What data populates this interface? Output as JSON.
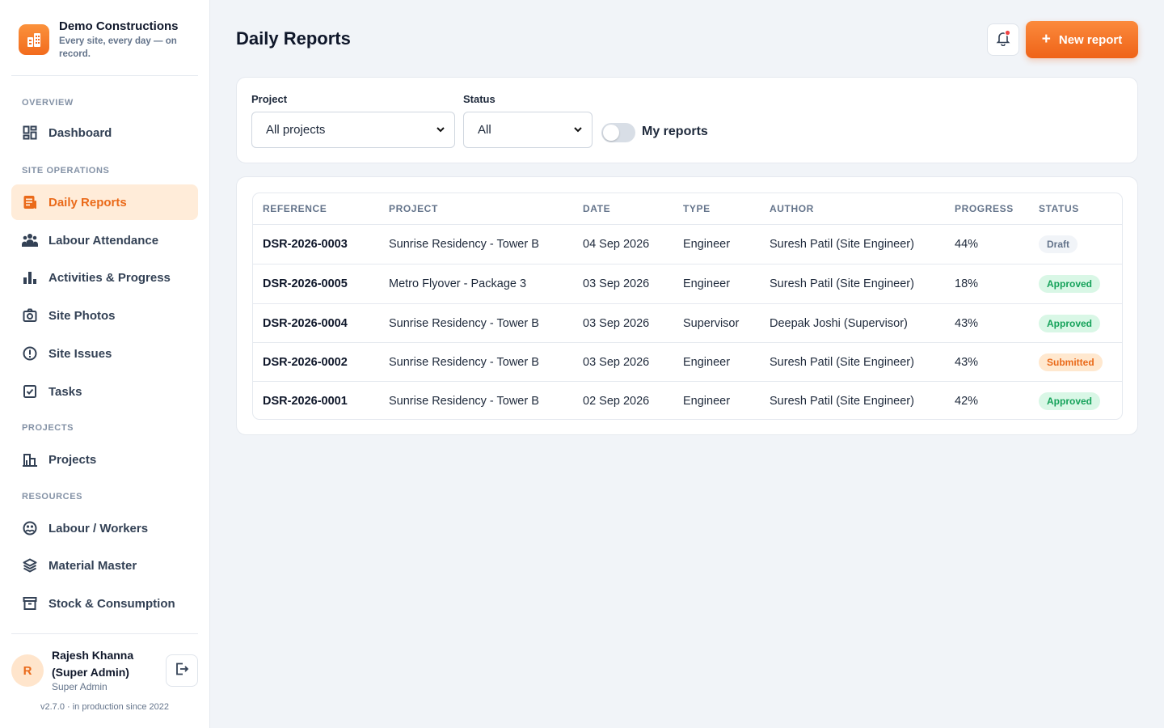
{
  "brand": {
    "name": "Demo Constructions",
    "tagline": "Every site, every day — on record."
  },
  "sidebar": {
    "sections": [
      {
        "label": "OVERVIEW",
        "items": [
          {
            "label": "Dashboard",
            "icon": "dashboard-icon"
          }
        ]
      },
      {
        "label": "SITE OPERATIONS",
        "items": [
          {
            "label": "Daily Reports",
            "icon": "report-icon",
            "active": true
          },
          {
            "label": "Labour Attendance",
            "icon": "people-icon"
          },
          {
            "label": "Activities & Progress",
            "icon": "bar-chart-icon"
          },
          {
            "label": "Site Photos",
            "icon": "camera-icon"
          },
          {
            "label": "Site Issues",
            "icon": "alert-circle-icon"
          },
          {
            "label": "Tasks",
            "icon": "checkbox-icon"
          }
        ]
      },
      {
        "label": "PROJECTS",
        "items": [
          {
            "label": "Projects",
            "icon": "building-icon"
          }
        ]
      },
      {
        "label": "RESOURCES",
        "items": [
          {
            "label": "Labour / Workers",
            "icon": "workers-icon"
          },
          {
            "label": "Material Master",
            "icon": "layers-icon"
          },
          {
            "label": "Stock & Consumption",
            "icon": "archive-icon"
          }
        ]
      }
    ]
  },
  "user": {
    "initial": "R",
    "name": "Rajesh Khanna (Super Admin)",
    "role": "Super Admin"
  },
  "version": "v2.7.0 · in production since 2022",
  "header": {
    "title": "Daily Reports",
    "new_label": "New report"
  },
  "filters": {
    "project_label": "Project",
    "project_value": "All projects",
    "status_label": "Status",
    "status_value": "All",
    "toggle_label": "My reports",
    "toggle_on": false
  },
  "table": {
    "columns": [
      "REFERENCE",
      "PROJECT",
      "DATE",
      "TYPE",
      "AUTHOR",
      "PROGRESS",
      "STATUS"
    ],
    "rows": [
      {
        "ref": "DSR-2026-0003",
        "project": "Sunrise Residency - Tower B",
        "date": "04 Sep 2026",
        "type": "Engineer",
        "author": "Suresh Patil (Site Engineer)",
        "progress": "44%",
        "status": "Draft"
      },
      {
        "ref": "DSR-2026-0005",
        "project": "Metro Flyover - Package 3",
        "date": "03 Sep 2026",
        "type": "Engineer",
        "author": "Suresh Patil (Site Engineer)",
        "progress": "18%",
        "status": "Approved"
      },
      {
        "ref": "DSR-2026-0004",
        "project": "Sunrise Residency - Tower B",
        "date": "03 Sep 2026",
        "type": "Supervisor",
        "author": "Deepak Joshi (Supervisor)",
        "progress": "43%",
        "status": "Approved"
      },
      {
        "ref": "DSR-2026-0002",
        "project": "Sunrise Residency - Tower B",
        "date": "03 Sep 2026",
        "type": "Engineer",
        "author": "Suresh Patil (Site Engineer)",
        "progress": "43%",
        "status": "Submitted"
      },
      {
        "ref": "DSR-2026-0001",
        "project": "Sunrise Residency - Tower B",
        "date": "02 Sep 2026",
        "type": "Engineer",
        "author": "Suresh Patil (Site Engineer)",
        "progress": "42%",
        "status": "Approved"
      }
    ]
  },
  "colors": {
    "accent": "#ef6318",
    "status": {
      "Draft": {
        "bg": "#f1f4f8",
        "fg": "#64748b"
      },
      "Approved": {
        "bg": "#d9f7e6",
        "fg": "#15a25a"
      },
      "Submitted": {
        "bg": "#ffe8cf",
        "fg": "#ea6a1a"
      }
    }
  }
}
